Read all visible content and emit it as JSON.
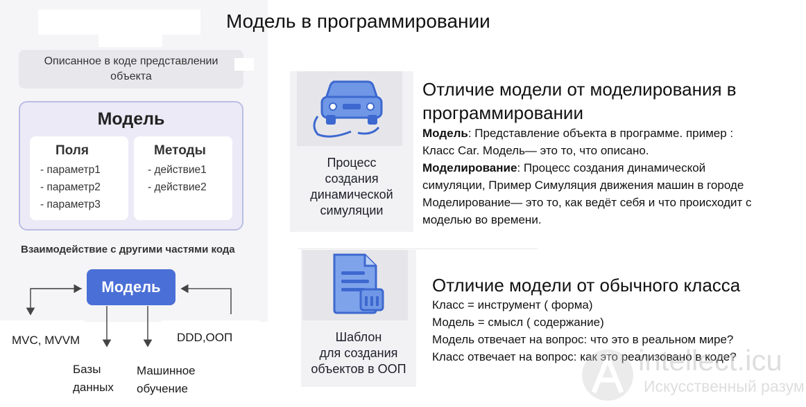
{
  "title": "Модель в программировании",
  "left": {
    "description_line1": "Описанное в коде представлении",
    "description_line2": "объекта",
    "model_title": "Модель",
    "fields": {
      "title": "Поля",
      "items": [
        "- параметр1",
        "- параметр2",
        "- параметр3"
      ]
    },
    "methods": {
      "title": "Методы",
      "items": [
        "- действие1",
        "- действие2"
      ]
    },
    "interaction_label": "Взаимодействие с другими частями кода",
    "model_button": "Модель",
    "connections": {
      "mvc": "MVC, MVVM",
      "db_line1": "Базы",
      "db_line2": "данных",
      "ml_line1": "Машинное",
      "ml_line2": "обучение",
      "ddd": "DDD,ООП"
    }
  },
  "cards": {
    "card1_lines": [
      "Процесс",
      "создания",
      "динамической",
      "симуляции"
    ],
    "card1_icon": "car-icon",
    "card2_lines": [
      "Шаблон",
      "для создания",
      "объектов в ООП"
    ],
    "card2_icon": "document-icon"
  },
  "section1": {
    "title_line1": "Отличие модели от моделирования в",
    "title_line2": "программировании",
    "model_term": "Модель",
    "model_text": ": Представление объекта в программе. пример :",
    "model_text2": "Класс Car. Модель— это то, что описано.",
    "modeling_term": "Моделирование",
    "modeling_text": ": Процесс создания динамической",
    "modeling_text2": "симуляции, Пример   Симуляция движения машин в городе",
    "modeling_text3": "Моделирование— это то, как ведёт себя и что происходит с",
    "modeling_text4": "моделью во времени."
  },
  "section2": {
    "title": "Отличие модели от обычного класса",
    "lines": [
      "Класс = инструмент  ( форма)",
      "Модель = смысл  ( содержание)",
      "Модель отвечает на вопрос: что это в реальном мире?",
      "Класс отвечает на вопрос: как это реализовано в коде?"
    ]
  },
  "watermark": {
    "main": "intellect.icu",
    "sub": "Искусственный разум"
  },
  "colors": {
    "accent": "#4a6fd6",
    "card_border": "#b9bde4",
    "card_bg": "#ebeaf6",
    "icon": "#4a78d8"
  }
}
